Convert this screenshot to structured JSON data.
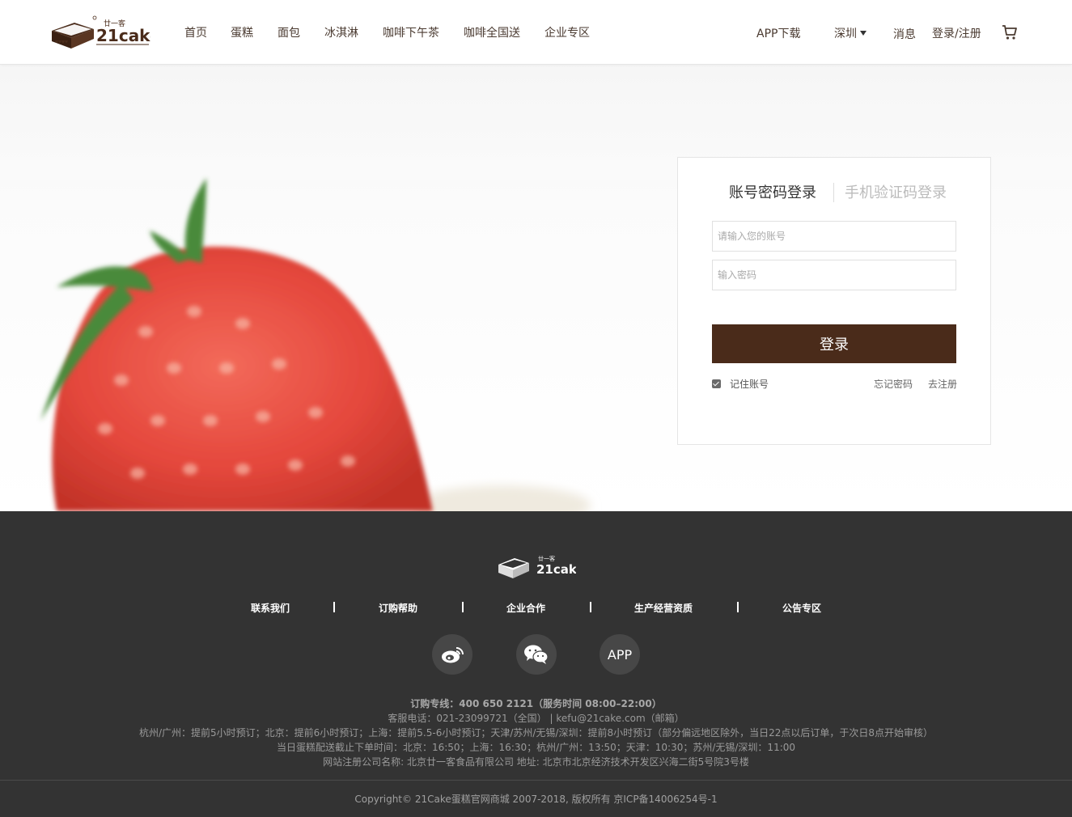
{
  "header": {
    "logo_brand": "21cake",
    "logo_cn": "廿一客",
    "nav": [
      {
        "label": "首页"
      },
      {
        "label": "蛋糕"
      },
      {
        "label": "面包"
      },
      {
        "label": "冰淇淋"
      },
      {
        "label": "咖啡下午茶"
      },
      {
        "label": "咖啡全国送"
      },
      {
        "label": "企业专区"
      }
    ],
    "app_download": "APP下载",
    "city": "深圳",
    "messages": "消息",
    "login_register": "登录/注册",
    "cart_icon": "cart-icon"
  },
  "hero": {
    "image": "strawberry-icon"
  },
  "login": {
    "tab_password": "账号密码登录",
    "tab_sms": "手机验证码登录",
    "account_placeholder": "请输入您的账号",
    "password_placeholder": "输入密码",
    "submit_label": "登录",
    "remember_label": "记住账号",
    "remember_checked": true,
    "forgot_label": "忘记密码",
    "register_label": "去注册"
  },
  "footer": {
    "logo_brand": "21cake",
    "logo_cn": "廿一客",
    "links": [
      {
        "label": "联系我们"
      },
      {
        "label": "订购帮助"
      },
      {
        "label": "企业合作"
      },
      {
        "label": "生产经营资质"
      },
      {
        "label": "公告专区"
      }
    ],
    "social": [
      {
        "name": "weibo-icon"
      },
      {
        "name": "wechat-icon"
      },
      {
        "label": "APP"
      }
    ],
    "hotline": "订购专线：400 650 2121（服务时间 08:00–22:00）",
    "service": "客服电话：021-23099721（全国） | kefu@21cake.com（邮箱）",
    "preorder": "杭州/广州：提前5小时预订；北京：提前6小时预订；上海：提前5.5-6小时预订；天津/苏州/无锡/深圳：提前8小时预订（部分偏远地区除外，当日22点以后订单，于次日8点开始审核）",
    "cutoff": "当日蛋糕配送截止下单时间：北京：16:50；上海：16:30；杭州/广州：13:50；天津：10:30；苏州/无锡/深圳：11:00",
    "company": "网站注册公司名称: 北京廿一客食品有限公司 地址: 北京市北京经济技术开发区兴海二街5号院3号楼",
    "copyright": "Copyright© 21Cake蛋糕官网商城 2007-2018, 版权所有 京ICP备14006254号-1"
  },
  "colors": {
    "brand_brown": "#4a2b1a",
    "footer_bg": "#333333"
  }
}
